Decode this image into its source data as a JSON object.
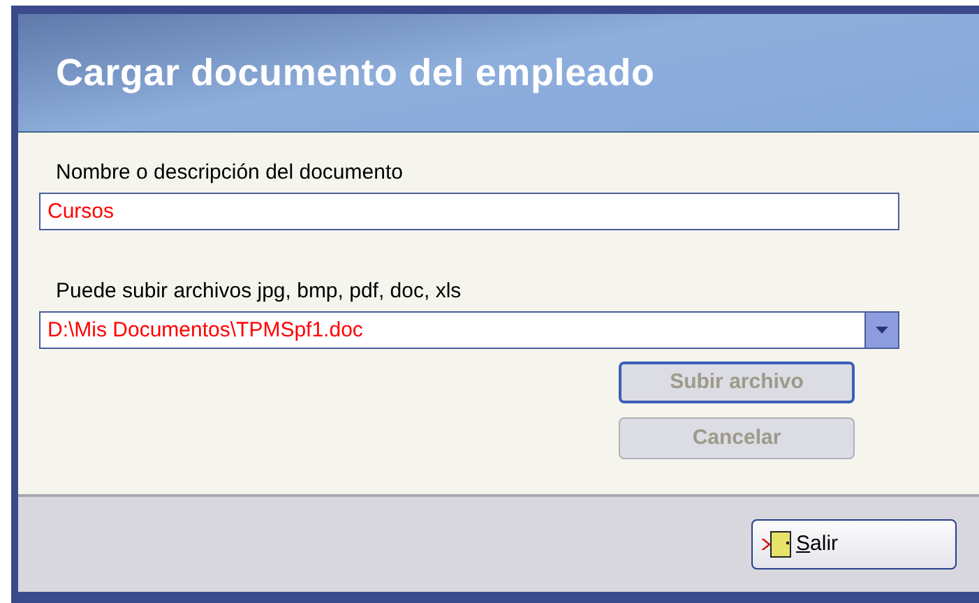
{
  "window": {
    "title": "Cargar documento del empleado"
  },
  "name_field": {
    "label": "Nombre o descripción del documento",
    "value": "Cursos"
  },
  "file_field": {
    "label": "Puede subir archivos jpg, bmp, pdf, doc, xls",
    "value": "D:\\Mis Documentos\\TPMSpf1.doc"
  },
  "actions": [
    {
      "label": "Subir archivo",
      "disabled": true,
      "focused": true
    },
    {
      "label": "Cancelar",
      "disabled": true,
      "focused": false
    }
  ],
  "footer": {
    "exit_button": {
      "label": "Salir"
    }
  }
}
